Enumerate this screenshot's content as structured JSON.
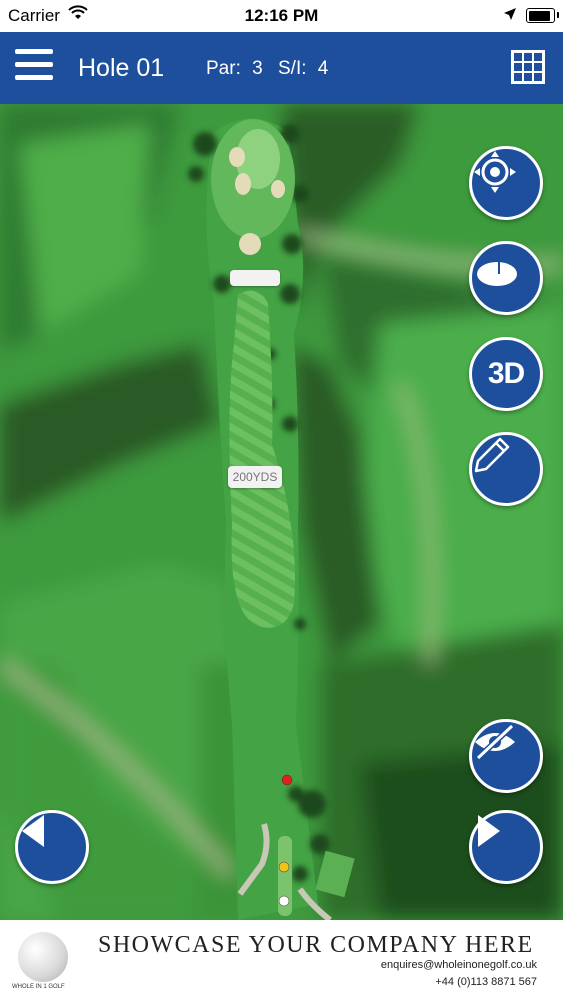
{
  "status_bar": {
    "carrier": "Carrier",
    "time": "12:16 PM"
  },
  "header": {
    "hole_title": "Hole 01",
    "par_label": "Par:",
    "par_value": "3",
    "si_label": "S/I:",
    "si_value": "4"
  },
  "map": {
    "markers": [
      {
        "label": ""
      },
      {
        "label": "200YDS"
      }
    ],
    "tee_colors": [
      "#e02020",
      "#f0c419",
      "#ffffff"
    ]
  },
  "controls": {
    "target_icon": "crosshair-target-icon",
    "green_icon": "green-flag-icon",
    "view_3d_label": "3D",
    "draw_icon": "pencil-icon",
    "hide_icon": "eye-slash-icon",
    "prev_icon": "arrow-left-icon",
    "next_icon": "arrow-right-icon"
  },
  "footer": {
    "logo_text": "WHOLE IN 1 GOLF",
    "headline": "SHOWCASE YOUR COMPANY HERE",
    "email": "enquires@wholeinonegolf.co.uk",
    "phone": "+44 (0)113 8871 567"
  },
  "colors": {
    "header": "#1d4f9c",
    "accent": "#1d4f9c"
  }
}
